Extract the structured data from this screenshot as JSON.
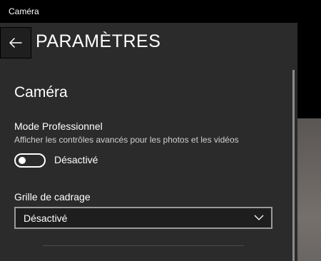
{
  "window": {
    "title": "Caméra"
  },
  "header": {
    "title": "PARAMÈTRES",
    "back_icon": "arrow-left-icon"
  },
  "section": {
    "title": "Caméra"
  },
  "pro_mode": {
    "label": "Mode Professionnel",
    "description": "Afficher les contrôles avancés pour les photos et les vidéos",
    "state": "Désactivé",
    "enabled": false
  },
  "framing_grid": {
    "label": "Grille de cadrage",
    "selected": "Désactivé",
    "chevron_icon": "chevron-down-icon"
  },
  "colors": {
    "panel_bg": "#2b2b2b",
    "window_bg": "#000000",
    "text": "#ffffff",
    "dropdown_border": "#9a9a9a"
  }
}
